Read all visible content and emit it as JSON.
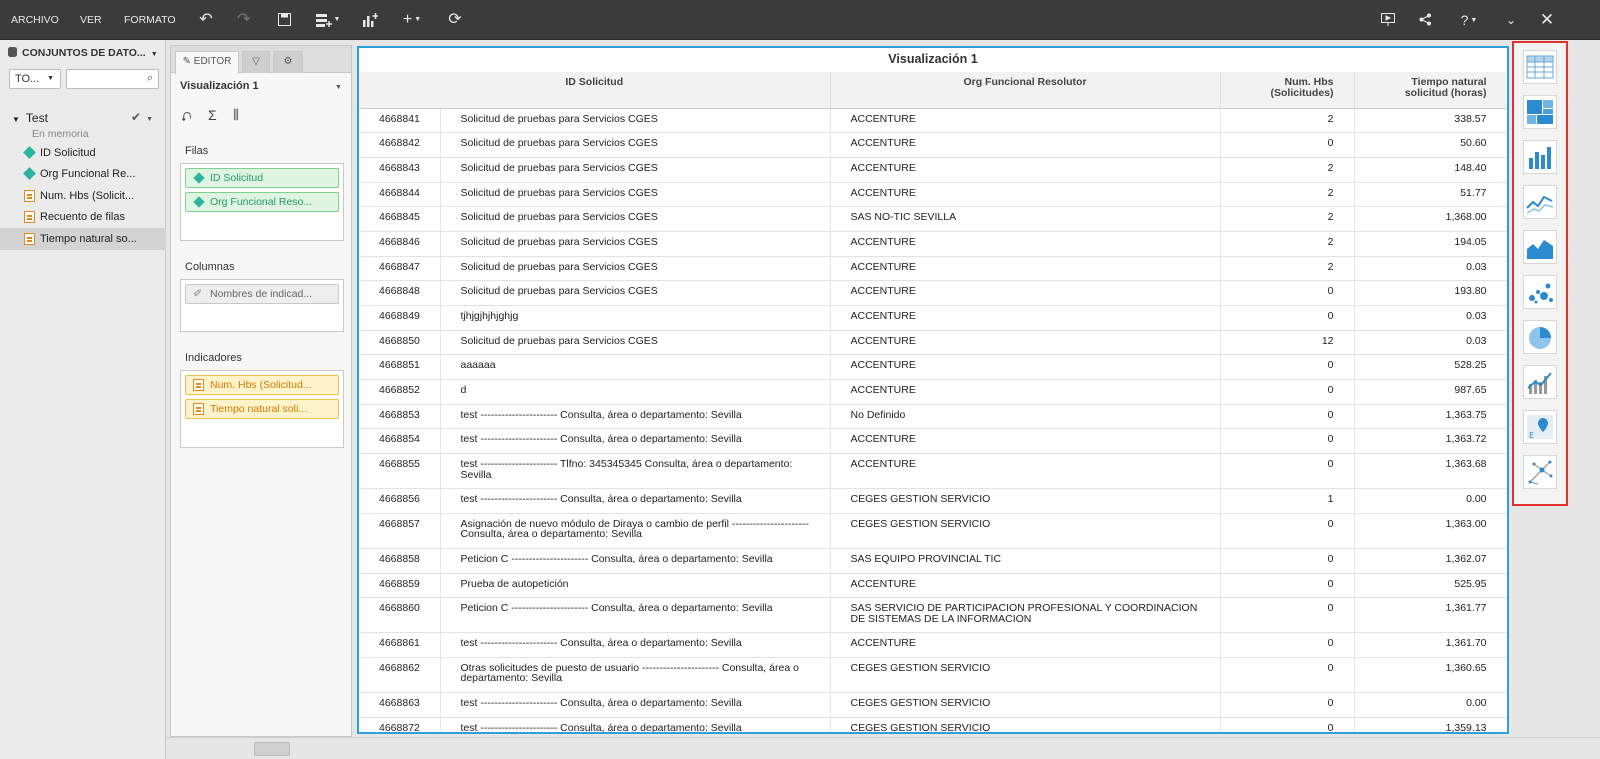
{
  "menu": {
    "archivo": "ARCHIVO",
    "ver": "VER",
    "formato": "FORMATO"
  },
  "toolbar_icons": [
    "undo-icon",
    "redo-icon",
    "save-icon",
    "add-dataset-icon",
    "add-visualization-icon",
    "add-icon",
    "refresh-icon",
    "presentation-icon",
    "share-icon",
    "help-icon",
    "collapse-icon",
    "close-icon"
  ],
  "toolbar": {
    "help_label": "?"
  },
  "datasets": {
    "header": "CONJUNTOS DE DATO...",
    "filter_value": "TO...",
    "search_placeholder": "",
    "group_name": "Test",
    "group_sub": "En memoria",
    "fields": [
      {
        "label": "ID Solicitud",
        "kind": "attribute"
      },
      {
        "label": "Org Funcional Re...",
        "kind": "attribute"
      },
      {
        "label": "Num. Hbs (Solicit...",
        "kind": "measure"
      },
      {
        "label": "Recuento de filas",
        "kind": "count"
      },
      {
        "label": "Tiempo natural so...",
        "kind": "measure",
        "selected": true
      }
    ]
  },
  "editor": {
    "tab_label": "EDITOR",
    "viz_name": "Visualización 1",
    "rows_title": "Filas",
    "rows": [
      "ID Solicitud",
      "Org Funcional Reso..."
    ],
    "cols_title": "Columnas",
    "cols": [
      "Nombres de indicad..."
    ],
    "ind_title": "Indicadores",
    "indicators": [
      "Num. Hbs (Solicitud...",
      "Tiempo natural soli..."
    ]
  },
  "grid": {
    "title": "Visualización 1",
    "headers": {
      "id": "ID Solicitud",
      "org": "Org Funcional Resolutor",
      "num": "Num. Hbs (Solicitudes)",
      "tiempo": "Tiempo natural solicitud (horas)"
    },
    "rows": [
      {
        "id": "4668841",
        "desc": "Solicitud de pruebas para Servicios CGES",
        "org": "ACCENTURE",
        "num": "2",
        "t": "338.57"
      },
      {
        "id": "4668842",
        "desc": "Solicitud de pruebas para Servicios CGES",
        "org": "ACCENTURE",
        "num": "0",
        "t": "50.60"
      },
      {
        "id": "4668843",
        "desc": "Solicitud de pruebas para Servicios CGES",
        "org": "ACCENTURE",
        "num": "2",
        "t": "148.40"
      },
      {
        "id": "4668844",
        "desc": "Solicitud de pruebas para Servicios CGES",
        "org": "ACCENTURE",
        "num": "2",
        "t": "51.77"
      },
      {
        "id": "4668845",
        "desc": "Solicitud de pruebas para Servicios CGES",
        "org": "SAS NO-TIC SEVILLA",
        "num": "2",
        "t": "1,368.00"
      },
      {
        "id": "4668846",
        "desc": "Solicitud de pruebas para Servicios CGES",
        "org": "ACCENTURE",
        "num": "2",
        "t": "194.05"
      },
      {
        "id": "4668847",
        "desc": "Solicitud de pruebas para Servicios CGES",
        "org": "ACCENTURE",
        "num": "2",
        "t": "0.03"
      },
      {
        "id": "4668848",
        "desc": "Solicitud de pruebas para Servicios CGES",
        "org": "ACCENTURE",
        "num": "0",
        "t": "193.80"
      },
      {
        "id": "4668849",
        "desc": "tjhjgjhjhjghjg",
        "org": "ACCENTURE",
        "num": "0",
        "t": "0.03"
      },
      {
        "id": "4668850",
        "desc": "Solicitud de pruebas para Servicios CGES",
        "org": "ACCENTURE",
        "num": "12",
        "t": "0.03"
      },
      {
        "id": "4668851",
        "desc": "aaaaaa",
        "org": "ACCENTURE",
        "num": "0",
        "t": "528.25"
      },
      {
        "id": "4668852",
        "desc": "d",
        "org": "ACCENTURE",
        "num": "0",
        "t": "987.65"
      },
      {
        "id": "4668853",
        "desc": "test ---------------------- Consulta, área o departamento: Sevilla",
        "org": "No Definido",
        "num": "0",
        "t": "1,363.75"
      },
      {
        "id": "4668854",
        "desc": "test ---------------------- Consulta, área o departamento: Sevilla",
        "org": "ACCENTURE",
        "num": "0",
        "t": "1,363.72"
      },
      {
        "id": "4668855",
        "desc": "test ---------------------- Tlfno: 345345345 Consulta, área o departamento: Sevilla",
        "org": "ACCENTURE",
        "num": "0",
        "t": "1,363.68",
        "tall": true
      },
      {
        "id": "4668856",
        "desc": "test ---------------------- Consulta, área o departamento: Sevilla",
        "org": "CEGES GESTION SERVICIO",
        "num": "1",
        "t": "0.00"
      },
      {
        "id": "4668857",
        "desc": "Asignación de nuevo módulo de Diraya o cambio de perfil ---------------------- Consulta, área o departamento: Sevilla",
        "org": "CEGES GESTION SERVICIO",
        "num": "0",
        "t": "1,363.00",
        "tall": true
      },
      {
        "id": "4668858",
        "desc": "Peticion C ---------------------- Consulta, área o departamento: Sevilla",
        "org": "SAS EQUIPO PROVINCIAL TIC",
        "num": "0",
        "t": "1,362.07"
      },
      {
        "id": "4668859",
        "desc": "Prueba de autopetición",
        "org": "ACCENTURE",
        "num": "0",
        "t": "525.95"
      },
      {
        "id": "4668860",
        "desc": "Peticion C ---------------------- Consulta, área o departamento: Sevilla",
        "org": "SAS SERVICIO DE PARTICIPACION PROFESIONAL Y COORDINACION DE SISTEMAS DE LA INFORMACION",
        "num": "0",
        "t": "1,361.77",
        "tall": true
      },
      {
        "id": "4668861",
        "desc": "test ---------------------- Consulta, área o departamento: Sevilla",
        "org": "ACCENTURE",
        "num": "0",
        "t": "1,361.70"
      },
      {
        "id": "4668862",
        "desc": "Otras solicitudes de puesto de usuario ---------------------- Consulta, área o departamento: Sevilla",
        "org": "CEGES GESTION SERVICIO",
        "num": "0",
        "t": "1,360.65",
        "tall": true
      },
      {
        "id": "4668863",
        "desc": "test ---------------------- Consulta, área o departamento: Sevilla",
        "org": "CEGES GESTION SERVICIO",
        "num": "0",
        "t": "0.00"
      },
      {
        "id": "4668872",
        "desc": "test ---------------------- Consulta, área o departamento: Sevilla",
        "org": "CEGES GESTION SERVICIO",
        "num": "0",
        "t": "1,359.13"
      }
    ]
  },
  "viz_types": [
    "table-icon",
    "treemap-icon",
    "bar-chart-icon",
    "line-chart-icon",
    "area-chart-icon",
    "scatter-icon",
    "pie-chart-icon",
    "combo-chart-icon",
    "map-icon",
    "network-icon"
  ],
  "colors": {
    "accent": "#2ca0d8",
    "highlight": "#e03030",
    "attribute": "#2bb4a0",
    "measure": "#e0891c"
  }
}
